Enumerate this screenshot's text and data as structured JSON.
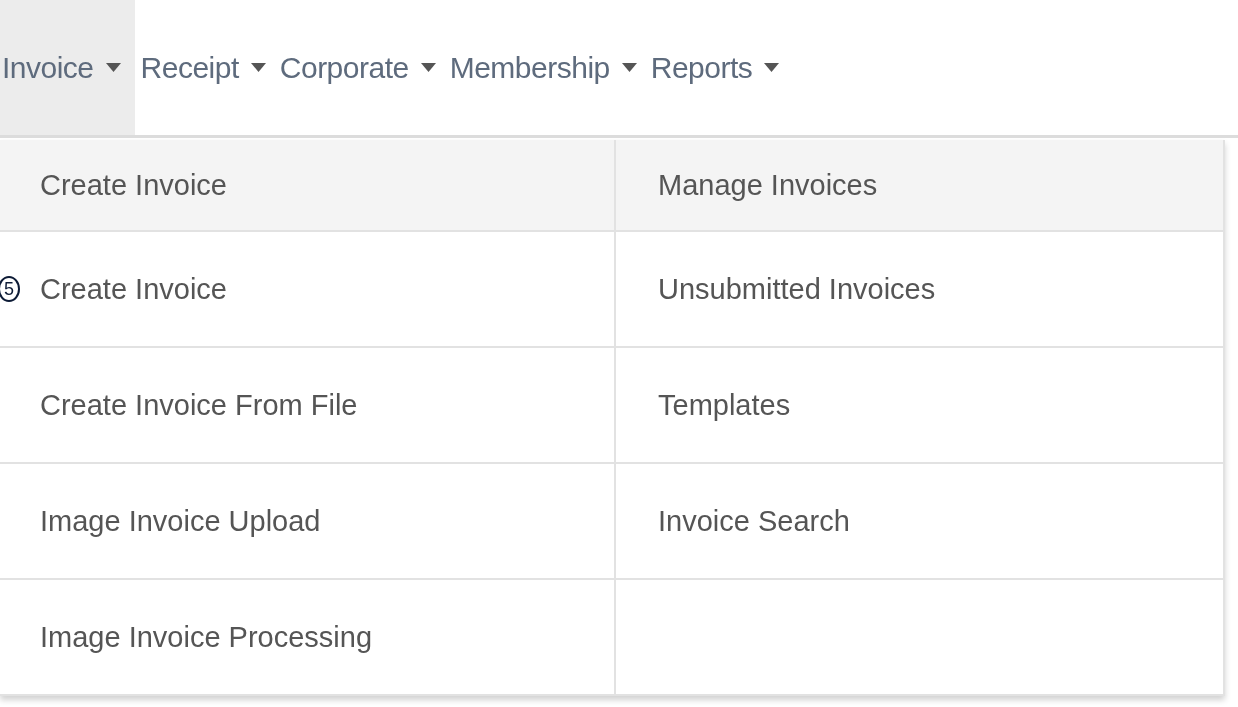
{
  "nav": {
    "items": [
      {
        "label": "Invoice",
        "selected": true
      },
      {
        "label": "Receipt",
        "selected": false
      },
      {
        "label": "Corporate",
        "selected": false
      },
      {
        "label": "Membership",
        "selected": false
      },
      {
        "label": "Reports",
        "selected": false
      }
    ]
  },
  "menu": {
    "columns": [
      {
        "header": "Create Invoice",
        "items": [
          {
            "label": "Create Invoice",
            "marker": "5"
          },
          {
            "label": "Create Invoice From File"
          },
          {
            "label": "Image Invoice Upload"
          },
          {
            "label": "Image Invoice Processing"
          }
        ]
      },
      {
        "header": "Manage Invoices",
        "items": [
          {
            "label": "Unsubmitted Invoices"
          },
          {
            "label": "Templates"
          },
          {
            "label": "Invoice Search"
          }
        ]
      }
    ]
  }
}
